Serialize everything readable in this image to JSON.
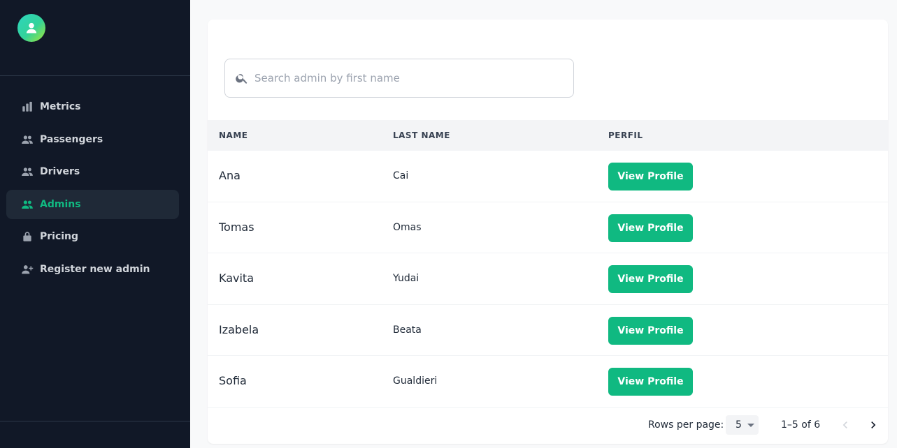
{
  "sidebar": {
    "logo_icon": "user-icon",
    "items": [
      {
        "label": "Metrics",
        "icon": "bar-chart-icon",
        "active": false
      },
      {
        "label": "Passengers",
        "icon": "group-icon",
        "active": false
      },
      {
        "label": "Drivers",
        "icon": "group-icon",
        "active": false
      },
      {
        "label": "Admins",
        "icon": "group-icon",
        "active": true
      },
      {
        "label": "Pricing",
        "icon": "lock-icon",
        "active": false
      },
      {
        "label": "Register new admin",
        "icon": "person-add-icon",
        "active": false
      }
    ]
  },
  "search": {
    "placeholder": "Search admin by first name",
    "value": ""
  },
  "table": {
    "headers": {
      "name": "NAME",
      "last_name": "LAST NAME",
      "profile": "PERFIL"
    },
    "rows": [
      {
        "name": "Ana",
        "last_name": "Cai",
        "action": "View Profile"
      },
      {
        "name": "Tomas",
        "last_name": "Omas",
        "action": "View Profile"
      },
      {
        "name": "Kavita",
        "last_name": "Yudai",
        "action": "View Profile"
      },
      {
        "name": "Izabela",
        "last_name": "Beata",
        "action": "View Profile"
      },
      {
        "name": "Sofia",
        "last_name": "Gualdieri",
        "action": "View Profile"
      }
    ]
  },
  "pagination": {
    "rows_per_page_label": "Rows per page:",
    "rows_per_page": "5",
    "range": "1–5 of 6"
  },
  "colors": {
    "accent": "#10b981",
    "sidebar_bg": "#111827"
  }
}
